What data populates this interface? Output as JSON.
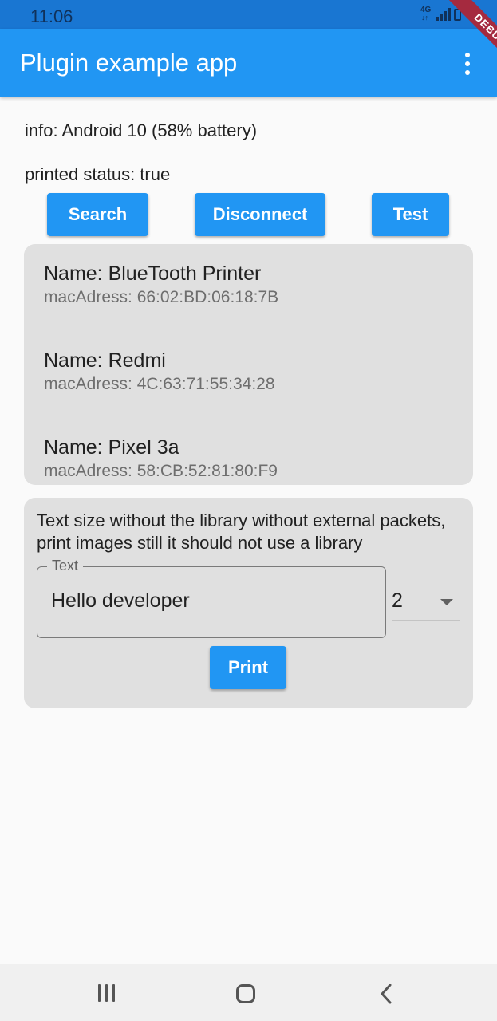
{
  "status_bar": {
    "time": "11:06",
    "network": "4G",
    "network_arrows": "↓↑"
  },
  "debug_banner": "DEBUG",
  "app_bar": {
    "title": "Plugin example app",
    "menu_icon": "more-vert-icon"
  },
  "info": "info: Android 10 (58% battery)",
  "printed_status": "printed status: true",
  "actions": {
    "search_label": "Search",
    "disconnect_label": "Disconnect",
    "test_label": "Test"
  },
  "devices": [
    {
      "name": "Name: BlueTooth Printer",
      "mac": "macAdress: 66:02:BD:06:18:7B"
    },
    {
      "name": "Name: Redmi",
      "mac": "macAdress: 4C:63:71:55:34:28"
    },
    {
      "name": "Name: Pixel 3a",
      "mac": "macAdress: 58:CB:52:81:80:F9"
    }
  ],
  "print_section": {
    "description": "Text size without the library without external packets, print images still it should not use a library",
    "text_field_label": "Text",
    "text_field_value": "Hello developer",
    "size_value": "2",
    "print_label": "Print"
  },
  "colors": {
    "primary": "#2196f3",
    "status_bar": "#1976d2",
    "panel": "#e0e0e0",
    "background": "#fafafa",
    "debug_ribbon": "#a52a3f"
  }
}
